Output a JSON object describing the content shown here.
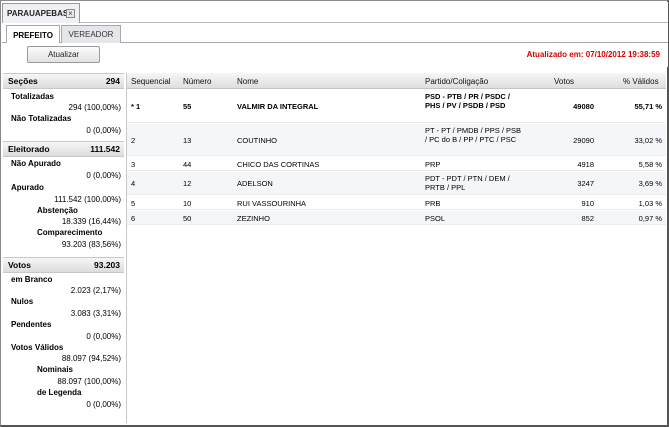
{
  "doc_tab": {
    "label": "PARAUAPEBAS",
    "close": "×"
  },
  "tabs": [
    {
      "label": "PREFEITO",
      "active": true
    },
    {
      "label": "VEREADOR",
      "active": false
    }
  ],
  "toolbar": {
    "update_label": "Atualizar",
    "updated_text": "Atualizado em: 07/10/2012 19:38:59",
    "updated_color": "#d40000"
  },
  "summary": {
    "secoes": {
      "title": "Seções",
      "total": "294",
      "totalizadas_label": "Totalizadas",
      "totalizadas_value": "294 (100,00%)",
      "nao_totalizadas_label": "Não Totalizadas",
      "nao_totalizadas_value": "0 (0,00%)"
    },
    "eleitorado": {
      "title": "Eleitorado",
      "total": "111.542",
      "nao_apurado_label": "Não Apurado",
      "nao_apurado_value": "0 (0,00%)",
      "apurado_label": "Apurado",
      "apurado_value": "111.542 (100,00%)",
      "abstencao_label": "Abstenção",
      "abstencao_value": "18.339 (16,44%)",
      "comparecimento_label": "Comparecimento",
      "comparecimento_value": "93.203 (83,56%)"
    },
    "votos": {
      "title": "Votos",
      "total": "93.203",
      "branco_label": "em Branco",
      "branco_value": "2.023 (2,17%)",
      "nulos_label": "Nulos",
      "nulos_value": "3.083 (3,31%)",
      "pendentes_label": "Pendentes",
      "pendentes_value": "0 (0,00%)",
      "validos_label": "Votos Válidos",
      "validos_value": "88.097 (94,52%)",
      "nominais_label": "Nominais",
      "nominais_value": "88.097 (100,00%)",
      "legenda_label": "de Legenda",
      "legenda_value": "0 (0,00%)"
    }
  },
  "table": {
    "headers": {
      "sequencial": "Sequencial",
      "numero": "Número",
      "nome": "Nome",
      "partido": "Partido/Coligação",
      "votos": "Votos",
      "validos": "% Válidos"
    },
    "rows": [
      {
        "seq": "* 1",
        "numero": "55",
        "nome": "VALMIR DA INTEGRAL",
        "partido": "PSD - PTB / PR / PSDC / PHS / PV / PSDB / PSD",
        "votos": "49080",
        "validos": "55,71 %"
      },
      {
        "seq": "2",
        "numero": "13",
        "nome": "COUTINHO",
        "partido": "PT - PT / PMDB / PPS / PSB / PC do B / PP / PTC / PSC",
        "votos": "29090",
        "validos": "33,02 %"
      },
      {
        "seq": "3",
        "numero": "44",
        "nome": "CHICO DAS CORTINAS",
        "partido": "PRP",
        "votos": "4918",
        "validos": "5,58 %"
      },
      {
        "seq": "4",
        "numero": "12",
        "nome": "ADELSON",
        "partido": "PDT - PDT / PTN / DEM / PRTB / PPL",
        "votos": "3247",
        "validos": "3,69 %"
      },
      {
        "seq": "5",
        "numero": "10",
        "nome": "RUI VASSOURINHA",
        "partido": "PRB",
        "votos": "910",
        "validos": "1,03 %"
      },
      {
        "seq": "6",
        "numero": "50",
        "nome": "ZEZINHO",
        "partido": "PSOL",
        "votos": "852",
        "validos": "0,97 %"
      }
    ]
  }
}
